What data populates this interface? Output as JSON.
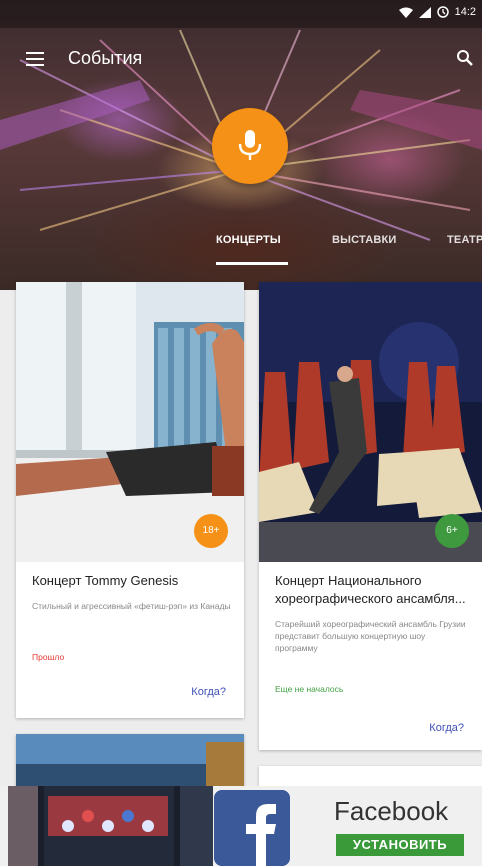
{
  "status": {
    "time": "14:2"
  },
  "toolbar": {
    "title": "События"
  },
  "tabs": [
    {
      "label": "КОНЦЕРТЫ",
      "active": true
    },
    {
      "label": "ВЫСТАВКИ",
      "active": false
    },
    {
      "label": "ТЕАТР",
      "active": false
    }
  ],
  "cards": [
    {
      "title": "Концерт Tommy Genesis",
      "description": "Стильный и агрессивный «фетиш-рэп» из Канады",
      "status": "Прошло",
      "status_color": "#e53935",
      "link": "Когда?",
      "badge": "18+",
      "badge_color": "#f49116"
    },
    {
      "title": "Концерт Национального хореографического ансамбля...",
      "description": "Старейший хореографический ансамбль Грузии представит большую концертную шоу программу",
      "status": "Еще не началось",
      "status_color": "#43a047",
      "link": "Когда?",
      "badge": "6+",
      "badge_color": "#3f9a3f"
    }
  ],
  "ad": {
    "name": "Facebook",
    "install": "УСТАНОВИТЬ"
  },
  "colors": {
    "accent": "#f49116",
    "link": "#3f51b5"
  }
}
